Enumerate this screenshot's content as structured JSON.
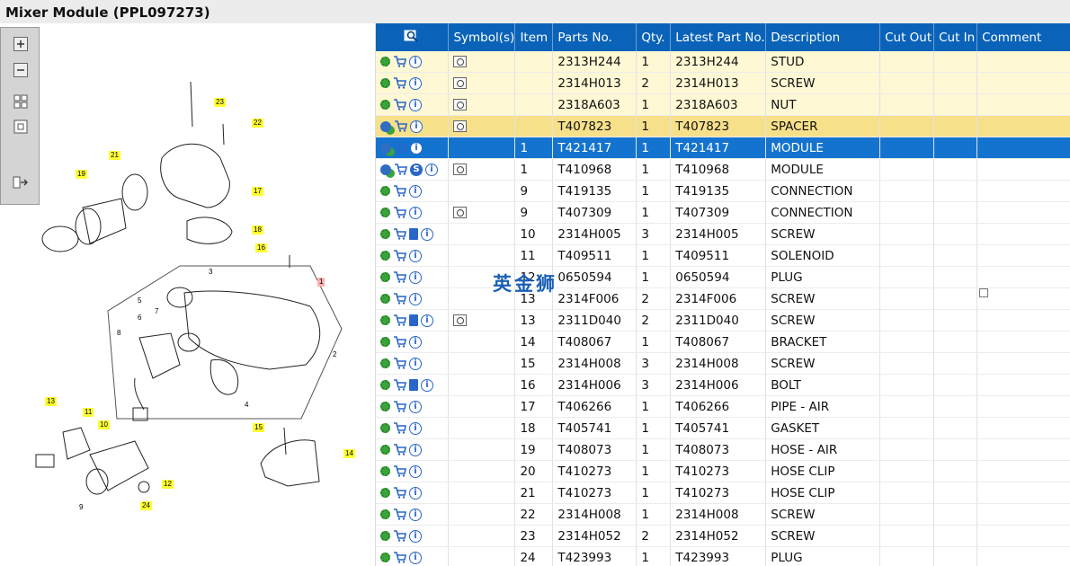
{
  "window": {
    "title": "Mixer Module (PPL097273)"
  },
  "toolbox": {
    "icons": [
      "zoom-in-icon",
      "zoom-out-icon",
      "grid-view-icon",
      "fit-icon",
      "export-icon"
    ]
  },
  "diagram": {
    "callouts_yellow": [
      "23",
      "22",
      "21",
      "19",
      "17",
      "18",
      "16",
      "13",
      "11",
      "10",
      "15",
      "14",
      "12",
      "24",
      "9"
    ],
    "callouts_plain": [
      "3",
      "5",
      "6",
      "7",
      "8",
      "2",
      "4"
    ],
    "callout_red": "1"
  },
  "table": {
    "columns": [
      "Symbol(s)",
      "Item",
      "Parts No.",
      "Qty.",
      "Latest Part No.",
      "Description",
      "Cut Out",
      "Cut In",
      "Comment"
    ],
    "rows": [
      {
        "icons": [
          "gear",
          "cart",
          "info"
        ],
        "sym": [
          "mag"
        ],
        "item": "",
        "part": "2313H244",
        "qty": "1",
        "latest": "2313H244",
        "desc": "STUD",
        "state": "hl"
      },
      {
        "icons": [
          "gear",
          "cart",
          "info"
        ],
        "sym": [
          "mag"
        ],
        "item": "",
        "part": "2314H013",
        "qty": "2",
        "latest": "2314H013",
        "desc": "SCREW",
        "state": "hl"
      },
      {
        "icons": [
          "gear",
          "cart",
          "info"
        ],
        "sym": [
          "mag"
        ],
        "item": "",
        "part": "2318A603",
        "qty": "1",
        "latest": "2318A603",
        "desc": "NUT",
        "state": "hl"
      },
      {
        "icons": [
          "gear2",
          "cart",
          "info"
        ],
        "sym": [
          "mag"
        ],
        "item": "",
        "part": "T407823",
        "qty": "1",
        "latest": "T407823",
        "desc": "SPACER",
        "state": "hl-strong"
      },
      {
        "icons": [
          "gear2",
          "cart",
          "info"
        ],
        "sym": [],
        "item": "1",
        "part": "T421417",
        "qty": "1",
        "latest": "T421417",
        "desc": "MODULE",
        "state": "sel"
      },
      {
        "icons": [
          "gear2",
          "cart",
          "s",
          "info"
        ],
        "sym": [
          "mag"
        ],
        "item": "1",
        "part": "T410968",
        "qty": "1",
        "latest": "T410968",
        "desc": "MODULE",
        "state": ""
      },
      {
        "icons": [
          "gear",
          "cart",
          "info"
        ],
        "sym": [],
        "item": "9",
        "part": "T419135",
        "qty": "1",
        "latest": "T419135",
        "desc": "CONNECTION",
        "state": ""
      },
      {
        "icons": [
          "gear",
          "cart",
          "info"
        ],
        "sym": [
          "mag"
        ],
        "item": "9",
        "part": "T407309",
        "qty": "1",
        "latest": "T407309",
        "desc": "CONNECTION",
        "state": ""
      },
      {
        "icons": [
          "gear",
          "cart",
          "book",
          "info"
        ],
        "sym": [],
        "item": "10",
        "part": "2314H005",
        "qty": "3",
        "latest": "2314H005",
        "desc": "SCREW",
        "state": ""
      },
      {
        "icons": [
          "gear",
          "cart",
          "info"
        ],
        "sym": [],
        "item": "11",
        "part": "T409511",
        "qty": "1",
        "latest": "T409511",
        "desc": "SOLENOID",
        "state": ""
      },
      {
        "icons": [
          "gear",
          "cart",
          "info"
        ],
        "sym": [],
        "item": "12",
        "part": "0650594",
        "qty": "1",
        "latest": "0650594",
        "desc": "PLUG",
        "state": ""
      },
      {
        "icons": [
          "gear",
          "cart",
          "info"
        ],
        "sym": [],
        "item": "13",
        "part": "2314F006",
        "qty": "2",
        "latest": "2314F006",
        "desc": "SCREW",
        "state": ""
      },
      {
        "icons": [
          "gear",
          "cart",
          "book",
          "info"
        ],
        "sym": [
          "mag"
        ],
        "item": "13",
        "part": "2311D040",
        "qty": "2",
        "latest": "2311D040",
        "desc": "SCREW",
        "state": ""
      },
      {
        "icons": [
          "gear",
          "cart",
          "info"
        ],
        "sym": [],
        "item": "14",
        "part": "T408067",
        "qty": "1",
        "latest": "T408067",
        "desc": "BRACKET",
        "state": ""
      },
      {
        "icons": [
          "gear",
          "cart",
          "info"
        ],
        "sym": [],
        "item": "15",
        "part": "2314H008",
        "qty": "3",
        "latest": "2314H008",
        "desc": "SCREW",
        "state": ""
      },
      {
        "icons": [
          "gear",
          "cart",
          "book",
          "info"
        ],
        "sym": [],
        "item": "16",
        "part": "2314H006",
        "qty": "3",
        "latest": "2314H006",
        "desc": "BOLT",
        "state": ""
      },
      {
        "icons": [
          "gear",
          "cart",
          "info"
        ],
        "sym": [],
        "item": "17",
        "part": "T406266",
        "qty": "1",
        "latest": "T406266",
        "desc": "PIPE - AIR",
        "state": ""
      },
      {
        "icons": [
          "gear",
          "cart",
          "info"
        ],
        "sym": [],
        "item": "18",
        "part": "T405741",
        "qty": "1",
        "latest": "T405741",
        "desc": "GASKET",
        "state": ""
      },
      {
        "icons": [
          "gear",
          "cart",
          "info"
        ],
        "sym": [],
        "item": "19",
        "part": "T408073",
        "qty": "1",
        "latest": "T408073",
        "desc": "HOSE - AIR",
        "state": ""
      },
      {
        "icons": [
          "gear",
          "cart",
          "info"
        ],
        "sym": [],
        "item": "20",
        "part": "T410273",
        "qty": "1",
        "latest": "T410273",
        "desc": "HOSE CLIP",
        "state": ""
      },
      {
        "icons": [
          "gear",
          "cart",
          "info"
        ],
        "sym": [],
        "item": "21",
        "part": "T410273",
        "qty": "1",
        "latest": "T410273",
        "desc": "HOSE CLIP",
        "state": ""
      },
      {
        "icons": [
          "gear",
          "cart",
          "info"
        ],
        "sym": [],
        "item": "22",
        "part": "2314H008",
        "qty": "1",
        "latest": "2314H008",
        "desc": "SCREW",
        "state": ""
      },
      {
        "icons": [
          "gear",
          "cart",
          "info"
        ],
        "sym": [],
        "item": "23",
        "part": "2314H052",
        "qty": "2",
        "latest": "2314H052",
        "desc": "SCREW",
        "state": ""
      },
      {
        "icons": [
          "gear",
          "cart",
          "info"
        ],
        "sym": [],
        "item": "24",
        "part": "T423993",
        "qty": "1",
        "latest": "T423993",
        "desc": "PLUG",
        "state": ""
      }
    ]
  },
  "watermark": "英金狮"
}
